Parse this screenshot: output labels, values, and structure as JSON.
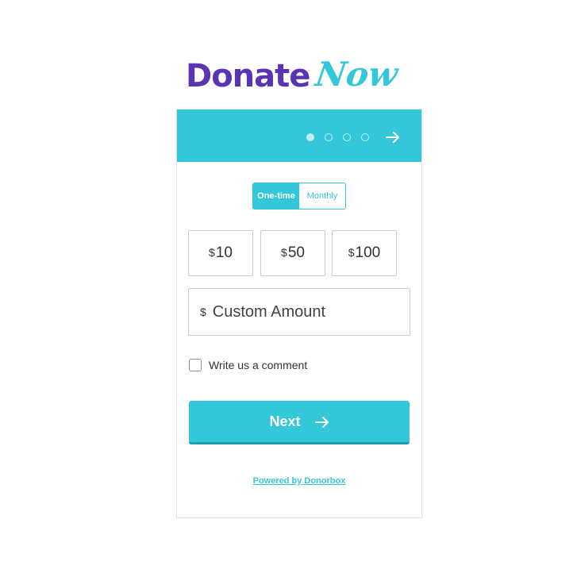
{
  "logo": {
    "part1": "Donate",
    "part2": "Now"
  },
  "progress": {
    "total_steps": 4,
    "current_step": 1
  },
  "frequency": {
    "options": [
      "One-time",
      "Monthly"
    ],
    "selected": "One-time"
  },
  "amounts": [
    {
      "currency": "$",
      "value": "10"
    },
    {
      "currency": "$",
      "value": "50"
    },
    {
      "currency": "$",
      "value": "100"
    }
  ],
  "custom_amount": {
    "currency": "$",
    "placeholder": "Custom Amount"
  },
  "comment": {
    "label": "Write us a comment",
    "checked": false
  },
  "next_button": {
    "label": "Next"
  },
  "footer": {
    "powered_by": "Powered by Donorbox"
  },
  "colors": {
    "accent": "#34c7d9",
    "brand_purple": "#5a34b3"
  }
}
